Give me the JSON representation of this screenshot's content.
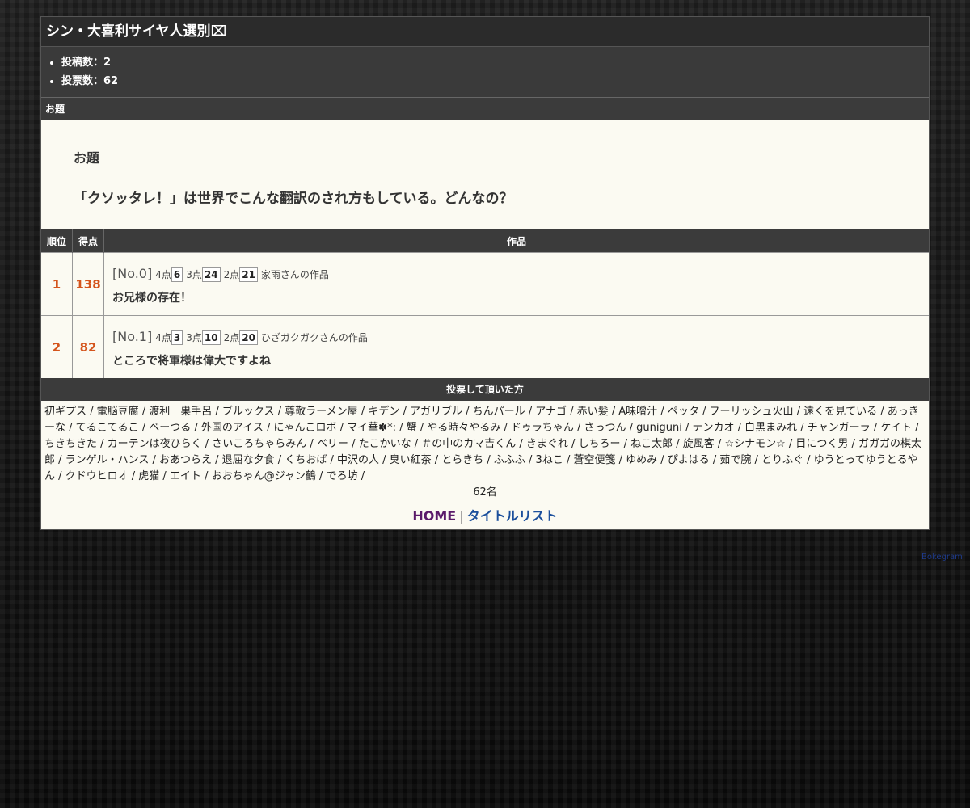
{
  "title": "シン・大喜利サイヤ人選別⌧",
  "stats": [
    "投稿数：2",
    "投票数：62"
  ],
  "odai_section": {
    "heading": "お題",
    "label": "お題",
    "text": "「クソッタレ！」は世界でこんな翻訳のされ方もしている。どんなの？"
  },
  "table": {
    "headers": [
      "順位",
      "得点",
      "作品"
    ],
    "rows": [
      {
        "rank": "1",
        "score": "138",
        "no": "[No.0]",
        "p4_label": "4点",
        "p4": "6",
        "p3_label": "3点",
        "p3": "24",
        "p2_label": "2点",
        "p2": "21",
        "author": "家雨さんの作品",
        "text": "お兄様の存在！"
      },
      {
        "rank": "2",
        "score": "82",
        "no": "[No.1]",
        "p4_label": "4点",
        "p4": "3",
        "p3_label": "3点",
        "p3": "10",
        "p2_label": "2点",
        "p2": "20",
        "author": "ひざガクガクさんの作品",
        "text": "ところで将軍様は偉大ですよね"
      }
    ]
  },
  "voters": {
    "heading": "投票して頂いた方",
    "list": "初ギプス / 電脳豆腐 / 渡利　巣手呂 / ブルックス / 尊敬ラーメン屋 / キデン / アガリブル / ちんパール / アナゴ / 赤い髪 / A味噌汁 / ペッタ / フーリッシュ火山 / 遠くを見ている / あっきーな / てるこてるこ / ベーつる / 外国のアイス / にゃんこロボ / マイ華✽*: / 蟹 / やる時々やるみ / ドゥラちゃん / さっつん / guniguni / テンカオ / 白黒まみれ / チャンガーラ / ケイト / ちきちきた / カーテンは夜ひらく / さいころちゃらみん / ベリー / たこかいな / ＃の中のカマ吉くん / きまぐれ / しちろー / ねこ太郎 / 旋風客 / ☆シナモン☆ / 目につく男 / ガガガの棋太郎 / ランゲル・ハンス / おあつらえ / 退屈な夕食 / くちおば / 中沢の人 / 臭い紅茶 / とらきち / ふふふ / 3ねこ / 蒼空便箋 / ゆめみ / ぴよはる / 茹で腕 / とりふぐ / ゆうとってゆうとるやん / クドウヒロオ / 虎猫 / エイト / おおちゃん@ジャン鶴 / でろ坊 /",
    "count": "62名"
  },
  "footer": {
    "home": "HOME",
    "separator": "|",
    "title_list": "タイトルリスト"
  },
  "credit": "Bokegram"
}
